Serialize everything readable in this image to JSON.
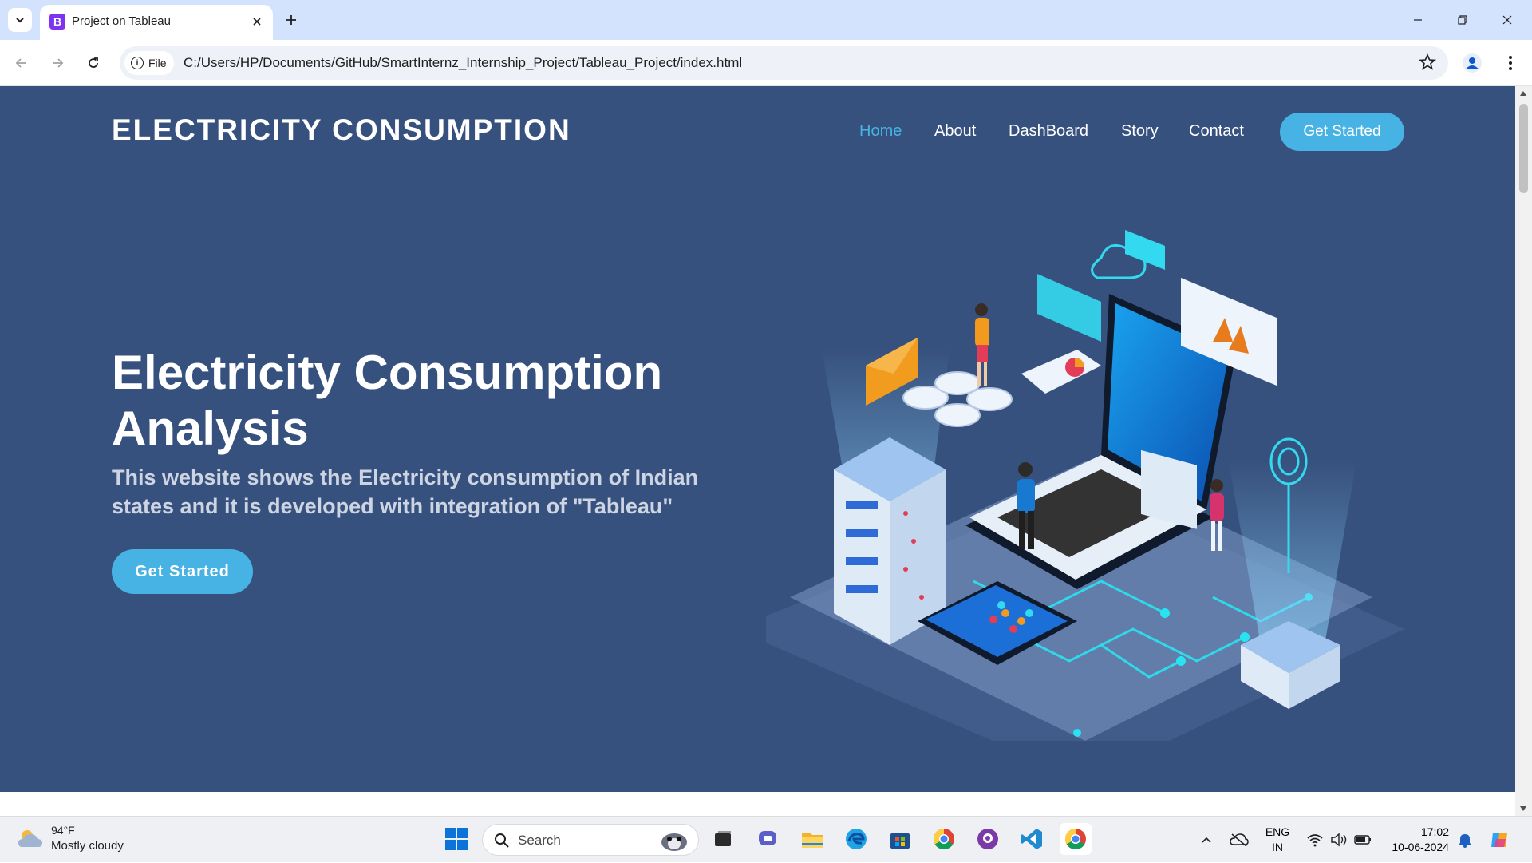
{
  "browser": {
    "tab_title": "Project on Tableau",
    "tab_favicon_letter": "B",
    "site_chip_label": "File",
    "url": "C:/Users/HP/Documents/GitHub/SmartInternz_Internship_Project/Tableau_Project/index.html"
  },
  "site": {
    "logo": "ELECTRICITY CONSUMPTION",
    "nav": [
      {
        "label": "Home",
        "active": true
      },
      {
        "label": "About",
        "active": false
      },
      {
        "label": "DashBoard",
        "active": false
      },
      {
        "label": "Story",
        "active": false
      },
      {
        "label": "Contact",
        "active": false
      }
    ],
    "nav_cta": "Get Started",
    "hero_title": "Electricity Consumption Analysis",
    "hero_subtitle": "This website shows the Electricity consumption of Indian states and it is developed with integration of \"Tableau\"",
    "hero_cta": "Get Started",
    "colors": {
      "background": "#37517e",
      "accent": "#47b2e4"
    }
  },
  "taskbar": {
    "weather_temp": "94°F",
    "weather_desc": "Mostly cloudy",
    "search_placeholder": "Search",
    "lang_line1": "ENG",
    "lang_line2": "IN",
    "time": "17:02",
    "date": "10-06-2024",
    "apps": [
      "windows-start",
      "search",
      "task-view",
      "teams",
      "file-explorer",
      "edge",
      "microsoft-store",
      "chrome",
      "github-desktop",
      "vscode",
      "chrome-active"
    ]
  }
}
